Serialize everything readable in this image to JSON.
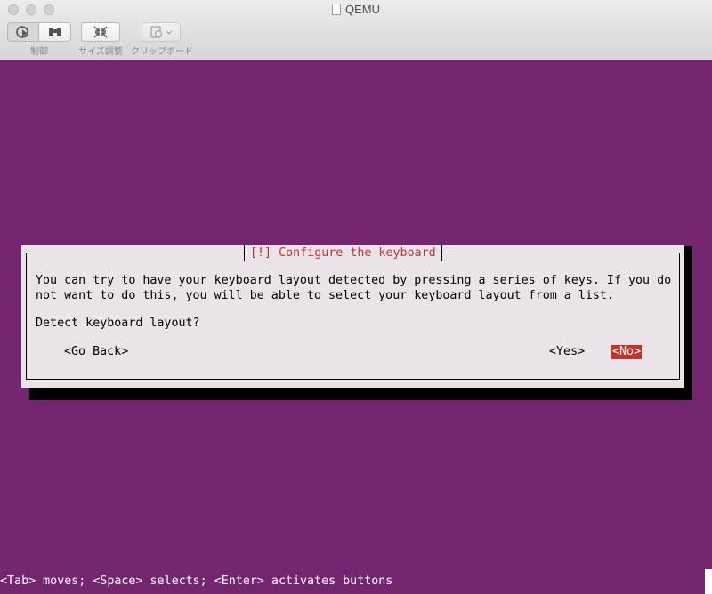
{
  "window": {
    "title": "QEMU",
    "toolbar": {
      "control_label": "制御",
      "resize_label": "サイズ調整",
      "clipboard_label": "クリップボード"
    }
  },
  "dialog": {
    "title": "[!] Configure the keyboard",
    "body_line1": "You can try to have your keyboard layout detected by pressing a series of keys. If you do",
    "body_line2": "not want to do this, you will be able to select your keyboard layout from a list.",
    "question": "Detect keyboard layout?",
    "buttons": {
      "go_back": "<Go Back>",
      "yes": "<Yes>",
      "no": "<No>"
    }
  },
  "statusbar": {
    "text": "<Tab> moves; <Space> selects; <Enter> activates buttons"
  },
  "colors": {
    "screen_background": "#742570",
    "dialog_background": "#e8e4e8",
    "accent_red": "#c4332a"
  }
}
